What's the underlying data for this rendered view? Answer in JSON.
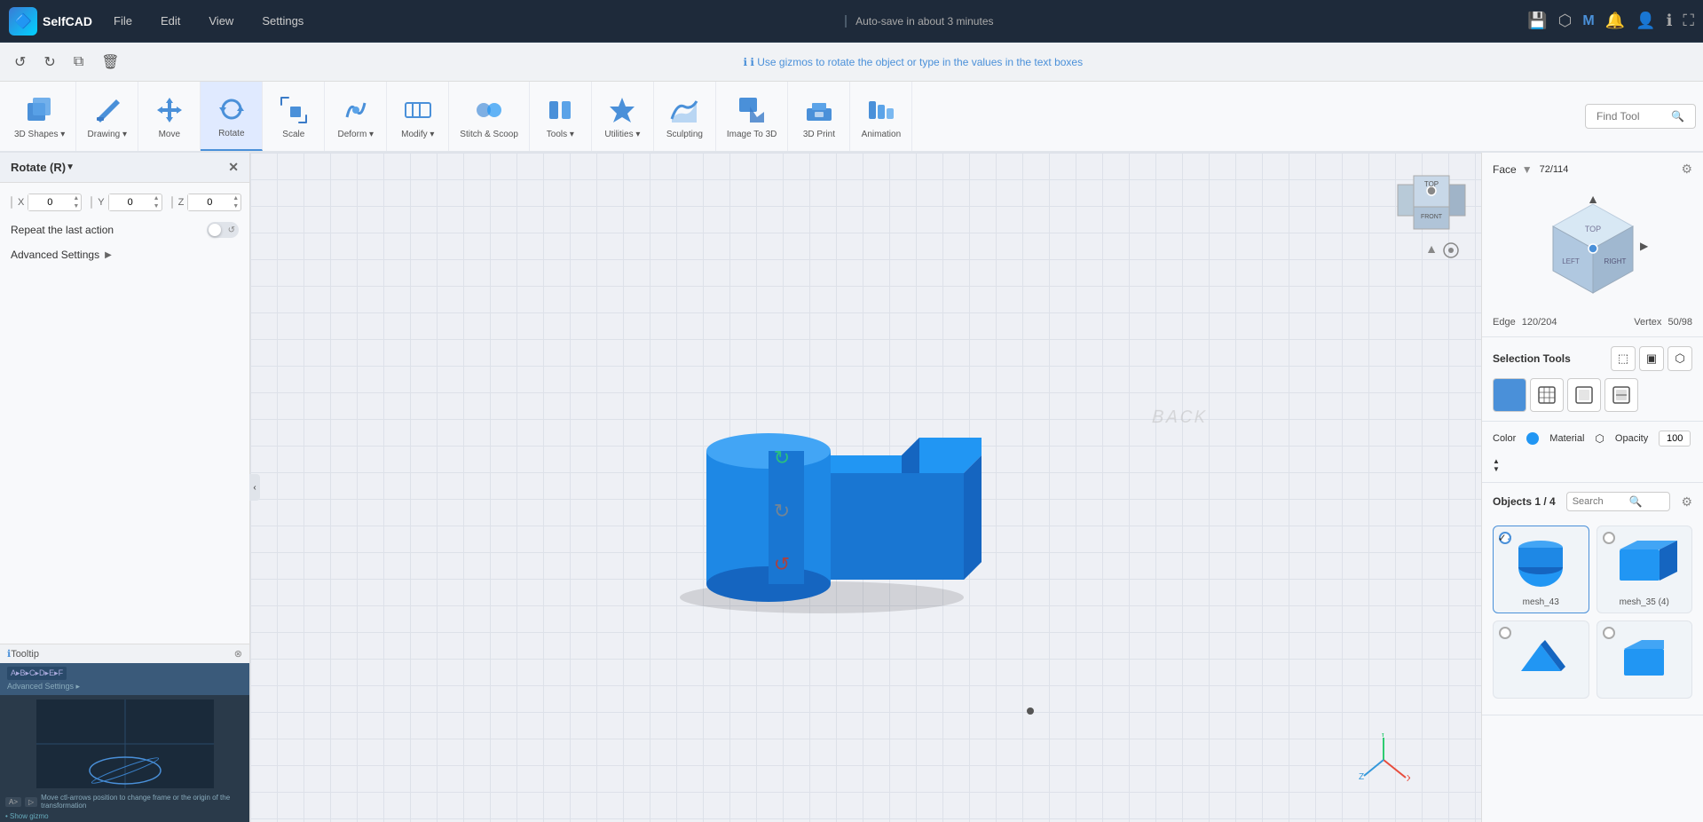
{
  "app": {
    "name": "SelfCAD",
    "autosave": "Auto-save in about 3 minutes"
  },
  "menu": {
    "file": "File",
    "edit": "Edit",
    "view": "View",
    "settings": "Settings"
  },
  "topicons": {
    "save": "💾",
    "share": "🔗",
    "m": "M",
    "bell": "🔔",
    "user": "👤",
    "info": "ℹ",
    "fullscreen": "⛶"
  },
  "toolbar": {
    "undo": "↺",
    "redo": "↻",
    "copy": "⧉",
    "delete": "🗑",
    "tip": "ℹ Use gizmos to rotate the object or type in the values in the text boxes",
    "tools": [
      {
        "id": "shapes3d",
        "label": "3D Shapes",
        "hasArrow": true,
        "icon": "cube3d"
      },
      {
        "id": "drawing",
        "label": "Drawing",
        "hasArrow": true,
        "icon": "drawing"
      },
      {
        "id": "move",
        "label": "Move",
        "hasArrow": false,
        "icon": "move"
      },
      {
        "id": "rotate",
        "label": "Rotate",
        "hasArrow": false,
        "icon": "rotate",
        "active": true
      },
      {
        "id": "scale",
        "label": "Scale",
        "hasArrow": false,
        "icon": "scale"
      },
      {
        "id": "deform",
        "label": "Deform",
        "hasArrow": true,
        "icon": "deform"
      },
      {
        "id": "modify",
        "label": "Modify",
        "hasArrow": true,
        "icon": "modify"
      },
      {
        "id": "stitch",
        "label": "Stitch & Scoop",
        "hasArrow": false,
        "icon": "stitch"
      },
      {
        "id": "tools",
        "label": "Tools",
        "hasArrow": true,
        "icon": "tools"
      },
      {
        "id": "utilities",
        "label": "Utilities",
        "hasArrow": true,
        "icon": "utilities"
      },
      {
        "id": "sculpting",
        "label": "Sculpting",
        "hasArrow": false,
        "icon": "sculpting"
      },
      {
        "id": "imageto3d",
        "label": "Image To 3D",
        "hasArrow": false,
        "icon": "image3d"
      },
      {
        "id": "3dprint",
        "label": "3D Print",
        "hasArrow": false,
        "icon": "print3d"
      },
      {
        "id": "animation",
        "label": "Animation",
        "hasArrow": false,
        "icon": "animation"
      }
    ],
    "findtool": {
      "label": "Find Tool",
      "placeholder": "Find Tool"
    }
  },
  "leftpanel": {
    "title": "Rotate (R)",
    "xAxis": {
      "label": "X",
      "value": "0"
    },
    "yAxis": {
      "label": "Y",
      "value": "0"
    },
    "zAxis": {
      "label": "Z",
      "value": "0"
    },
    "repeatAction": "Repeat the last action",
    "advancedSettings": "Advanced Settings",
    "tooltip": "Tooltip",
    "videoPlayer": "Video Player"
  },
  "rightpanel": {
    "faceLabel": "Face",
    "faceSelect": "Face",
    "faceCount": "72/114",
    "edgeLabel": "Edge",
    "edgeCount": "120/204",
    "vertexLabel": "Vertex",
    "vertexCount": "50/98",
    "selectionToolsLabel": "Selection Tools",
    "colorLabel": "Color",
    "materialLabel": "Material",
    "opacityLabel": "Opacity",
    "opacityValue": "100",
    "objectsLabel": "Objects 1 / 4",
    "searchPlaceholder": "Search",
    "objects": [
      {
        "id": "mesh43",
        "name": "mesh_43",
        "selected": true
      },
      {
        "id": "mesh35",
        "name": "mesh_35 (4)",
        "selected": false
      },
      {
        "id": "mesh_a",
        "name": "",
        "selected": false
      },
      {
        "id": "mesh_b",
        "name": "",
        "selected": false
      }
    ]
  },
  "canvas": {
    "backLabel": "BACK"
  }
}
